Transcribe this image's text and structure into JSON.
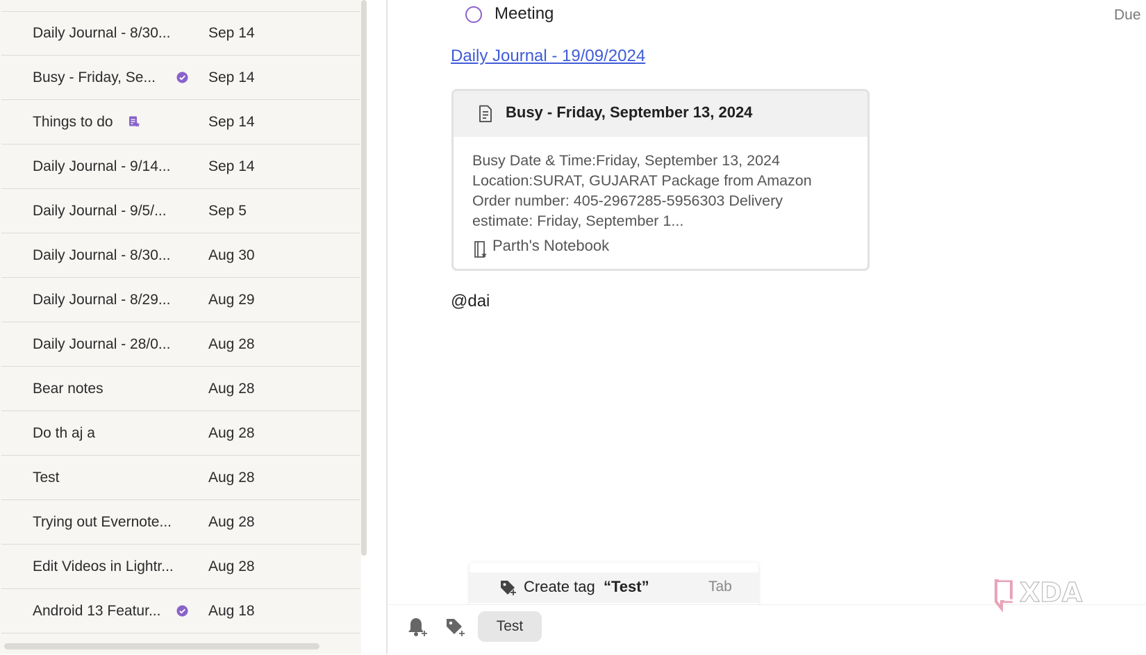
{
  "note_list": [
    {
      "title": "Daily Journal - 8/30...",
      "date": "Sep 14",
      "badge": ""
    },
    {
      "title": "Busy - Friday, Se...",
      "date": "Sep 14",
      "badge": "verified-icon"
    },
    {
      "title": "Things to do",
      "date": "Sep 14",
      "badge": "note-star-icon"
    },
    {
      "title": "Daily Journal - 9/14...",
      "date": "Sep 14",
      "badge": ""
    },
    {
      "title": "Daily Journal - 9/5/...",
      "date": "Sep 5",
      "badge": ""
    },
    {
      "title": "Daily Journal - 8/30...",
      "date": "Aug 30",
      "badge": ""
    },
    {
      "title": "Daily Journal - 8/29...",
      "date": "Aug 29",
      "badge": ""
    },
    {
      "title": "Daily Journal - 28/0...",
      "date": "Aug 28",
      "badge": ""
    },
    {
      "title": "Bear notes",
      "date": "Aug 28",
      "badge": ""
    },
    {
      "title": "Do th aj a",
      "date": "Aug 28",
      "badge": ""
    },
    {
      "title": "Test",
      "date": "Aug 28",
      "badge": ""
    },
    {
      "title": "Trying out Evernote...",
      "date": "Aug 28",
      "badge": ""
    },
    {
      "title": "Edit Videos in Lightr...",
      "date": "Aug 28",
      "badge": ""
    },
    {
      "title": "Android 13 Featur...",
      "date": "Aug 18",
      "badge": "verified-icon"
    }
  ],
  "editor": {
    "task_label": "Meeting",
    "due_label": "Due",
    "link_text": "Daily Journal - 19/09/2024",
    "card": {
      "title": "Busy - Friday, September 13, 2024",
      "body_lines": [
        "Busy Date & Time:Friday, September 13, 2024",
        "Location:SURAT, GUJARAT Package from Amazon",
        "Order number: 405-2967285-5956303 Delivery",
        "estimate: Friday, September 1..."
      ],
      "notebook": "Parth's Notebook"
    },
    "mention_text": "@dai"
  },
  "tag_popup": {
    "label": "Create tag",
    "value": "“Test”",
    "hint": "Tab"
  },
  "bottom_bar": {
    "tag_chip": "Test"
  },
  "colors": {
    "accent_purple": "#8a62c9",
    "link_blue": "#3f5bd8",
    "list_bg": "#f7f6f3"
  },
  "logo_text": "XDA"
}
